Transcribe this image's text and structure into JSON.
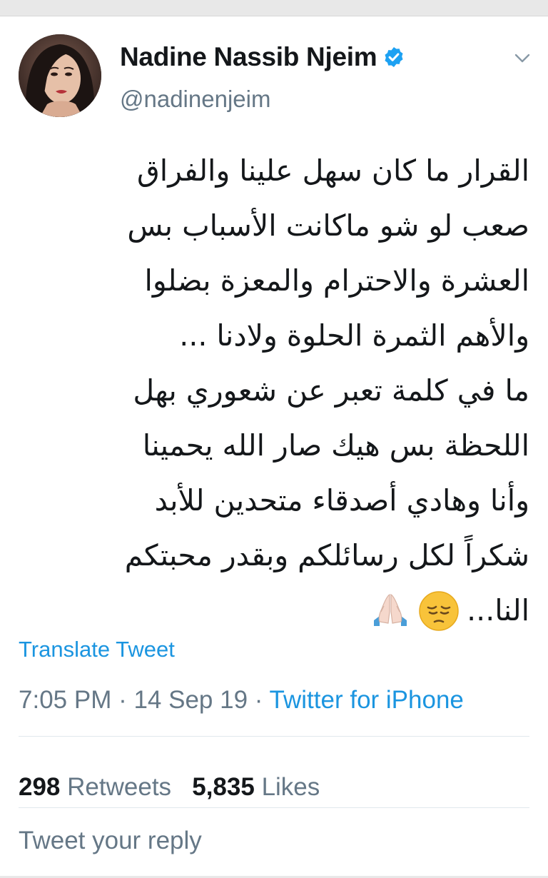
{
  "user": {
    "display_name": "Nadine Nassib Njeim",
    "handle": "@nadinenjeim",
    "verified": true,
    "avatar_icon": "profile-photo"
  },
  "icons": {
    "verified": "verified-badge-icon",
    "menu": "chevron-down-icon",
    "emoji_1": "pensive-face-emoji",
    "emoji_2": "folded-hands-emoji"
  },
  "tweet": {
    "lines": [
      "القرار ما كان سهل علينا والفراق",
      "صعب لو شو ماكانت الأسباب بس",
      "العشرة والاحترام والمعزة بضلوا",
      "والأهم الثمرة الحلوة ولادنا ...",
      "ما في كلمة تعبر عن شعوري بهل",
      "اللحظة بس هيك صار الله يحمينا",
      "وأنا وهادي أصدقاء متحدين للأبد",
      "شكراً لكل رسائلكم وبقدر محبتكم"
    ],
    "last_line_text": "النا...",
    "translate_label": "Translate Tweet"
  },
  "meta": {
    "time": "7:05 PM",
    "separator": " · ",
    "date": "14 Sep 19",
    "source": "Twitter for iPhone"
  },
  "stats": {
    "retweets_count": "298",
    "retweets_label": "Retweets",
    "likes_count": "5,835",
    "likes_label": "Likes"
  },
  "reply": {
    "placeholder": "Tweet your reply"
  },
  "colors": {
    "link": "#1b95e0",
    "secondary_text": "#657786",
    "primary_text": "#14171a",
    "verified_badge": "#1da1f2"
  }
}
